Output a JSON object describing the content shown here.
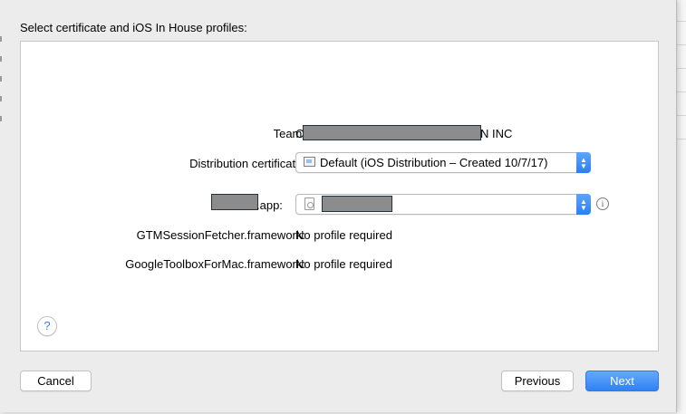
{
  "dialog": {
    "header": "Select certificate and iOS In House profiles:"
  },
  "team": {
    "label": "Team:",
    "value_prefix": "C",
    "value_suffix": "N INC"
  },
  "certificate": {
    "label": "Distribution certificate:",
    "selected": "Default (iOS Distribution – Created 10/7/17)"
  },
  "app": {
    "label_suffix": ".app:"
  },
  "frameworks": [
    {
      "label": "GTMSessionFetcher.framework:",
      "value": "No profile required"
    },
    {
      "label": "GoogleToolboxForMac.framework:",
      "value": "No profile required"
    }
  ],
  "icons": {
    "help": "?",
    "info": "i",
    "chevron_up": "▲",
    "chevron_down": "▼"
  },
  "buttons": {
    "cancel": "Cancel",
    "previous": "Previous",
    "next": "Next"
  }
}
